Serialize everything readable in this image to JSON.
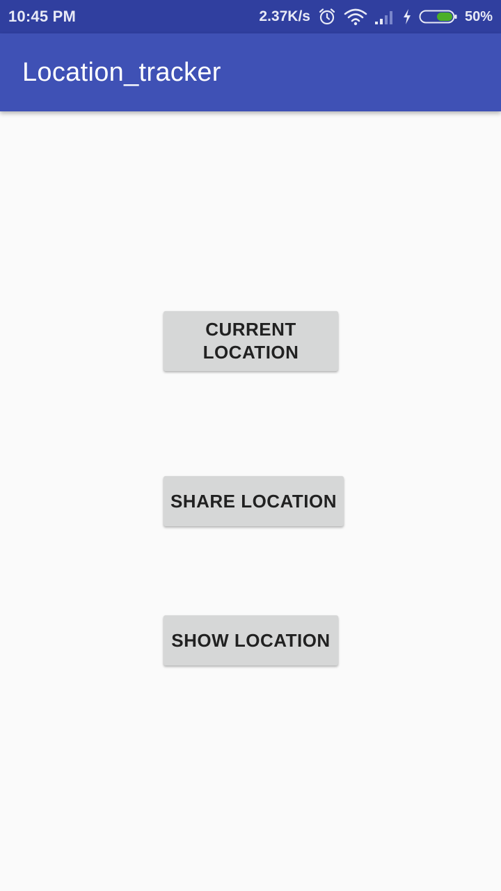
{
  "status_bar": {
    "time": "10:45 PM",
    "net_speed": "2.37K/s",
    "battery_percent": "50%",
    "battery_level": 0.5,
    "icons": [
      "alarm-icon",
      "wifi-icon",
      "signal-icon",
      "charging-icon",
      "battery-icon"
    ]
  },
  "app_bar": {
    "title": "Location_tracker"
  },
  "buttons": {
    "current_location": "CURRENT LOCATION",
    "share_location": "SHARE LOCATION",
    "show_location": "SHOW LOCATION"
  },
  "colors": {
    "status_bar": "#303f9f",
    "app_bar": "#3f51b5",
    "background": "#fafafa",
    "button": "#d6d7d7",
    "battery_fill": "#4caf28"
  }
}
